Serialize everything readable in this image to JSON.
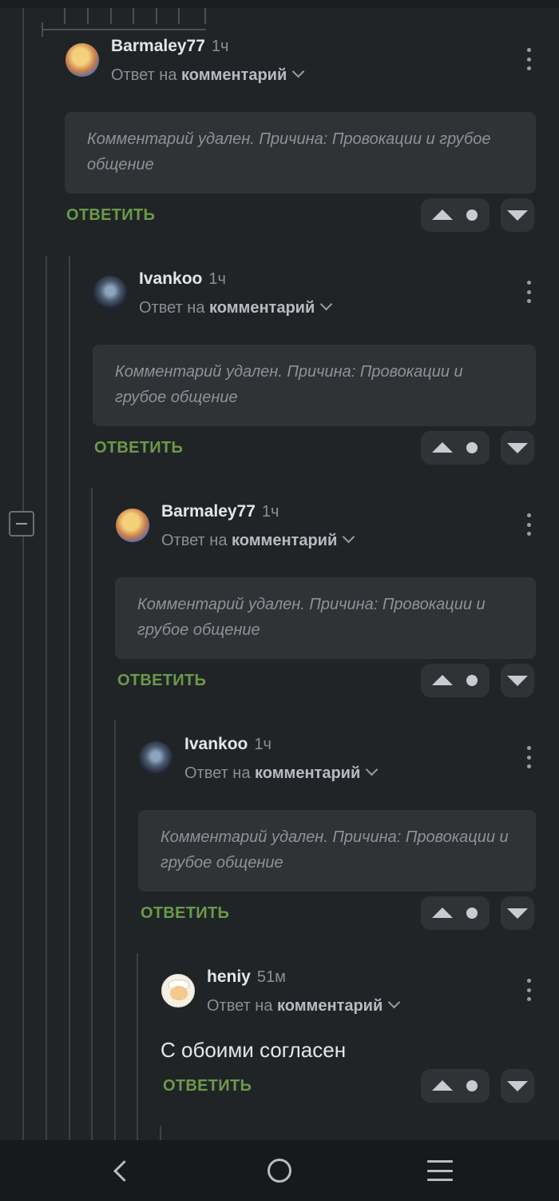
{
  "comments": [
    {
      "author": "Barmaley77",
      "time": "1ч",
      "reply_prefix": "Ответ на",
      "reply_target": "комментарий",
      "text": "Комментарий удален. Причина: Провокации и грубое общение",
      "reply_label": "ОТВЕТИТЬ",
      "avatar": "barmaley-avatar"
    },
    {
      "author": "Ivankoo",
      "time": "1ч",
      "reply_prefix": "Ответ на",
      "reply_target": "комментарий",
      "text": "Комментарий удален. Причина: Провокации и грубое общение",
      "reply_label": "ОТВЕТИТЬ",
      "avatar": "ivankoo-avatar"
    },
    {
      "author": "Barmaley77",
      "time": "1ч",
      "reply_prefix": "Ответ на",
      "reply_target": "комментарий",
      "text": "Комментарий удален. Причина: Провокации и грубое общение",
      "reply_label": "ОТВЕТИТЬ",
      "avatar": "barmaley-avatar"
    },
    {
      "author": "Ivankoo",
      "time": "1ч",
      "reply_prefix": "Ответ на",
      "reply_target": "комментарий",
      "text": "Комментарий удален. Причина: Провокации и грубое общение",
      "reply_label": "ОТВЕТИТЬ",
      "avatar": "ivankoo-avatar"
    },
    {
      "author": "heniy",
      "time": "51м",
      "reply_prefix": "Ответ на",
      "reply_target": "комментарий",
      "text": "С обоими согласен",
      "reply_label": "ОТВЕТИТЬ",
      "avatar": "heniy-avatar"
    }
  ],
  "icons": {
    "collapse": "minus-icon",
    "upvote": "triangle-up-icon",
    "downvote": "triangle-down-icon",
    "more": "kebab-icon",
    "nav_back": "chevron-left-icon",
    "nav_home": "circle-icon",
    "nav_menu": "hamburger-icon"
  },
  "colors": {
    "background": "#212427",
    "card": "#303236",
    "reply_accent": "#6a9a4a",
    "text_primary": "#e6e6e6",
    "text_muted": "#8b8f95"
  }
}
